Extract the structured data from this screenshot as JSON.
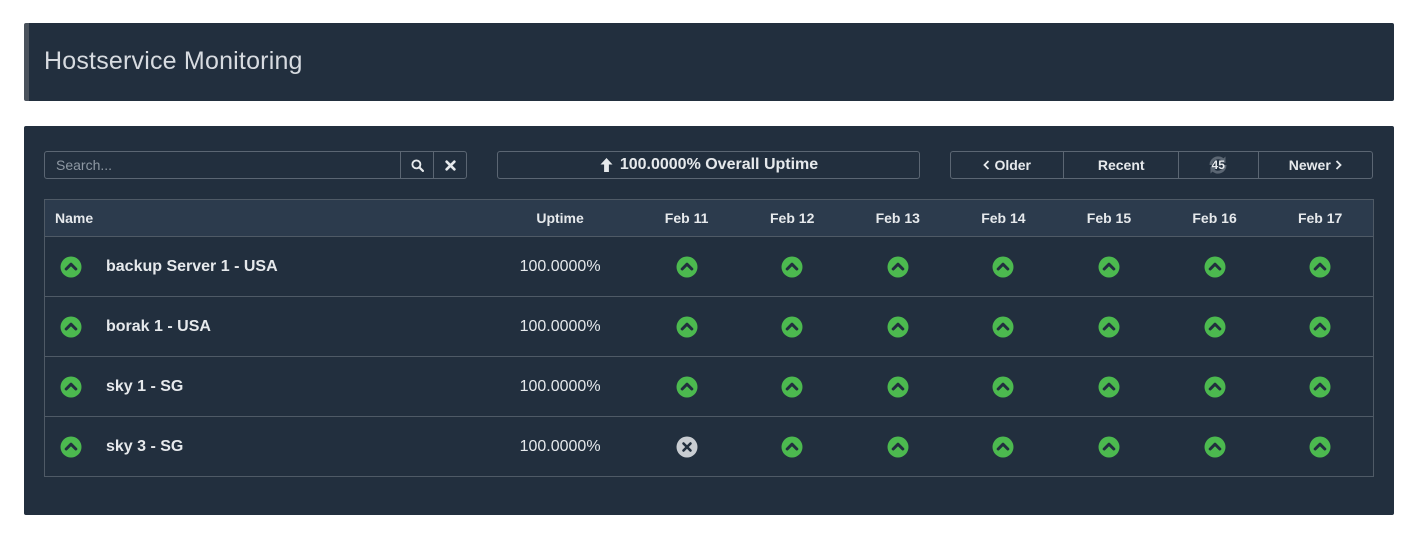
{
  "page": {
    "title": "Hostservice Monitoring"
  },
  "toolbar": {
    "search_placeholder": "Search...",
    "search_value": "",
    "overall_uptime": "100.0000% Overall Uptime",
    "older_label": "Older",
    "recent_label": "Recent",
    "refresh_count": "45",
    "newer_label": "Newer"
  },
  "table": {
    "headers": {
      "name": "Name",
      "uptime": "Uptime",
      "days": [
        "Feb 11",
        "Feb 12",
        "Feb 13",
        "Feb 14",
        "Feb 15",
        "Feb 16",
        "Feb 17"
      ]
    },
    "rows": [
      {
        "name": "backup Server 1 - USA",
        "status": "up",
        "uptime": "100.0000%",
        "days": [
          "up",
          "up",
          "up",
          "up",
          "up",
          "up",
          "up"
        ]
      },
      {
        "name": "borak 1 - USA",
        "status": "up",
        "uptime": "100.0000%",
        "days": [
          "up",
          "up",
          "up",
          "up",
          "up",
          "up",
          "up"
        ]
      },
      {
        "name": "sky 1 - SG",
        "status": "up",
        "uptime": "100.0000%",
        "days": [
          "up",
          "up",
          "up",
          "up",
          "up",
          "up",
          "up"
        ]
      },
      {
        "name": "sky 3 - SG",
        "status": "up",
        "uptime": "100.0000%",
        "days": [
          "no-data",
          "up",
          "up",
          "up",
          "up",
          "up",
          "up"
        ]
      }
    ]
  },
  "colors": {
    "background": "#ffffff",
    "panel": "#222f3e",
    "header_row": "#2c3b4d",
    "up_green": "#4cb94f",
    "no_data_gray": "#c9cdd2",
    "border": "#5b6673"
  },
  "icons": {
    "status_up": "chevron-up-circle-icon",
    "status_no_data": "x-circle-icon",
    "search": "search-icon",
    "clear": "close-icon",
    "uptime": "arrow-up-icon",
    "older": "chevron-left-icon",
    "newer": "chevron-right-icon",
    "refresh": "refresh-icon"
  }
}
